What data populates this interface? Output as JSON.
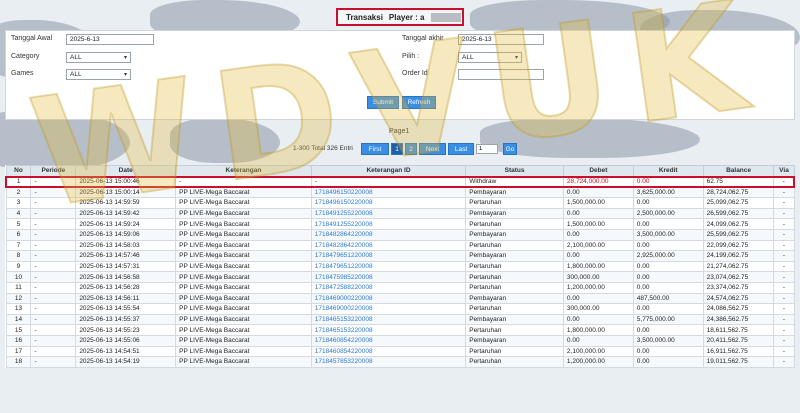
{
  "header": {
    "title": "Transaksi",
    "player_label": "Player : a"
  },
  "filters": {
    "tanggal_awal_label": "Tanggal Awal",
    "tanggal_awal_value": "2025-6-13",
    "category_label": "Category",
    "category_value": "ALL",
    "games_label": "Games",
    "games_value": "ALL",
    "tanggal_akhir_label": "Tanggal akhir",
    "tanggal_akhir_value": "2025-6-13",
    "pilih_label": "Pilih :",
    "pilih_value": "ALL",
    "order_id_label": "Order Id",
    "order_id_value": "",
    "submit_label": "Submit",
    "refresh_label": "Refresh"
  },
  "pager": {
    "page_title": "Page1",
    "info": "1-300 Total 326 Entri",
    "first_label": "First",
    "page1": "1",
    "page2": "2",
    "next_label": "Next",
    "last_label": "Last",
    "page_input_value": "1",
    "go_label": "Go"
  },
  "watermark": "WDVUK",
  "table": {
    "headers": [
      "No",
      "Periode",
      "Date",
      "Keterangan",
      "Keterangan ID",
      "Status",
      "Debet",
      "Kredit",
      "Balance",
      "Via"
    ],
    "rows": [
      [
        "1",
        "-",
        "2025-06-13 15:00:46",
        "-",
        "-",
        "Withdraw",
        "28,724,000.00",
        "0.00",
        "62.75",
        "-"
      ],
      [
        "2",
        "-",
        "2025-06-13 15:00:14",
        "PP LIVE-Mega Baccarat",
        "1718496150220008",
        "Pembayaran",
        "0.00",
        "3,625,000.00",
        "28,724,062.75",
        "-"
      ],
      [
        "3",
        "-",
        "2025-06-13 14:59:59",
        "PP LIVE-Mega Baccarat",
        "1718496150220008",
        "Pertaruhan",
        "1,500,000.00",
        "0.00",
        "25,099,062.75",
        "-"
      ],
      [
        "4",
        "-",
        "2025-06-13 14:59:42",
        "PP LIVE-Mega Baccarat",
        "1718491255220008",
        "Pembayaran",
        "0.00",
        "2,500,000.00",
        "26,599,062.75",
        "-"
      ],
      [
        "5",
        "-",
        "2025-06-13 14:59:24",
        "PP LIVE-Mega Baccarat",
        "1718491255220008",
        "Pertaruhan",
        "1,500,000.00",
        "0.00",
        "24,099,062.75",
        "-"
      ],
      [
        "6",
        "-",
        "2025-06-13 14:59:06",
        "PP LIVE-Mega Baccarat",
        "1718482864220008",
        "Pembayaran",
        "0.00",
        "3,500,000.00",
        "25,599,062.75",
        "-"
      ],
      [
        "7",
        "-",
        "2025-06-13 14:58:03",
        "PP LIVE-Mega Baccarat",
        "1718482864220008",
        "Pertaruhan",
        "2,100,000.00",
        "0.00",
        "22,099,062.75",
        "-"
      ],
      [
        "8",
        "-",
        "2025-06-13 14:57:46",
        "PP LIVE-Mega Baccarat",
        "1718479651220008",
        "Pembayaran",
        "0.00",
        "2,925,000.00",
        "24,199,062.75",
        "-"
      ],
      [
        "9",
        "-",
        "2025-06-13 14:57:31",
        "PP LIVE-Mega Baccarat",
        "1718479651220008",
        "Pertaruhan",
        "1,800,000.00",
        "0.00",
        "21,274,062.75",
        "-"
      ],
      [
        "10",
        "-",
        "2025-06-13 14:56:58",
        "PP LIVE-Mega Baccarat",
        "1718475985220008",
        "Pertaruhan",
        "300,000.00",
        "0.00",
        "23,074,062.75",
        "-"
      ],
      [
        "11",
        "-",
        "2025-06-13 14:56:28",
        "PP LIVE-Mega Baccarat",
        "1718472588220008",
        "Pertaruhan",
        "1,200,000.00",
        "0.00",
        "23,374,062.75",
        "-"
      ],
      [
        "12",
        "-",
        "2025-06-13 14:56:11",
        "PP LIVE-Mega Baccarat",
        "1718469000220008",
        "Pembayaran",
        "0.00",
        "487,500.00",
        "24,574,062.75",
        "-"
      ],
      [
        "13",
        "-",
        "2025-06-13 14:55:54",
        "PP LIVE-Mega Baccarat",
        "1718469000220008",
        "Pertaruhan",
        "300,000.00",
        "0.00",
        "24,086,562.75",
        "-"
      ],
      [
        "14",
        "-",
        "2025-06-13 14:55:37",
        "PP LIVE-Mega Baccarat",
        "1718465153220008",
        "Pembayaran",
        "0.00",
        "5,775,000.00",
        "24,386,562.75",
        "-"
      ],
      [
        "15",
        "-",
        "2025-06-13 14:55:23",
        "PP LIVE-Mega Baccarat",
        "1718465153220008",
        "Pertaruhan",
        "1,800,000.00",
        "0.00",
        "18,611,562.75",
        "-"
      ],
      [
        "16",
        "-",
        "2025-06-13 14:55:06",
        "PP LIVE-Mega Baccarat",
        "1718460854220008",
        "Pembayaran",
        "0.00",
        "3,500,000.00",
        "20,411,562.75",
        "-"
      ],
      [
        "17",
        "-",
        "2025-06-13 14:54:51",
        "PP LIVE-Mega Baccarat",
        "1718460854220008",
        "Pertaruhan",
        "2,100,000.00",
        "0.00",
        "16,911,562.75",
        "-"
      ],
      [
        "18",
        "-",
        "2025-06-13 14:54:19",
        "PP LIVE-Mega Baccarat",
        "1718457853220008",
        "Pertaruhan",
        "1,200,000.00",
        "0.00",
        "19,011,562.75",
        "-"
      ]
    ]
  }
}
